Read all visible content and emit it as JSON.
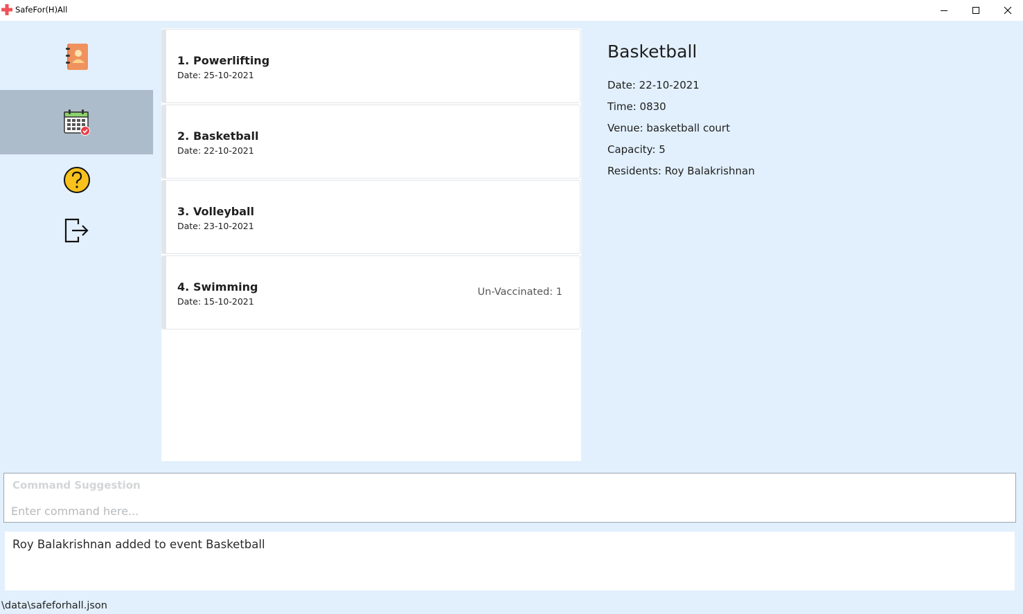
{
  "window": {
    "title": "SafeFor(H)All"
  },
  "sidebar": {
    "items": [
      {
        "name": "residents",
        "icon": "address-book-icon",
        "selected": false
      },
      {
        "name": "events",
        "icon": "calendar-icon",
        "selected": true
      },
      {
        "name": "help",
        "icon": "help-icon",
        "selected": false
      },
      {
        "name": "exit",
        "icon": "exit-icon",
        "selected": false
      }
    ],
    "selected_color": "#adbccb"
  },
  "events": [
    {
      "index": "1.",
      "name": "Powerlifting",
      "date": "Date: 25-10-2021",
      "unvaccinated": ""
    },
    {
      "index": "2.",
      "name": "Basketball",
      "date": "Date: 22-10-2021",
      "unvaccinated": ""
    },
    {
      "index": "3.",
      "name": "Volleyball",
      "date": "Date: 23-10-2021",
      "unvaccinated": ""
    },
    {
      "index": "4.",
      "name": "Swimming",
      "date": "Date: 15-10-2021",
      "unvaccinated": "Un-Vaccinated: 1"
    }
  ],
  "detail": {
    "title": "Basketball",
    "date": "Date: 22-10-2021",
    "time": "Time: 0830",
    "venue": "Venue: basketball court",
    "capacity": "Capacity: 5",
    "residents": "Residents: Roy Balakrishnan"
  },
  "command": {
    "suggestion": "Command Suggestion",
    "placeholder": "Enter command here...",
    "value": ""
  },
  "result": {
    "message": "Roy Balakrishnan added to event Basketball"
  },
  "status": {
    "path": "\\data\\safeforhall.json"
  },
  "colors": {
    "background": "#e2f0fd",
    "panel": "#ffffff",
    "accent_red": "#e8414a"
  }
}
